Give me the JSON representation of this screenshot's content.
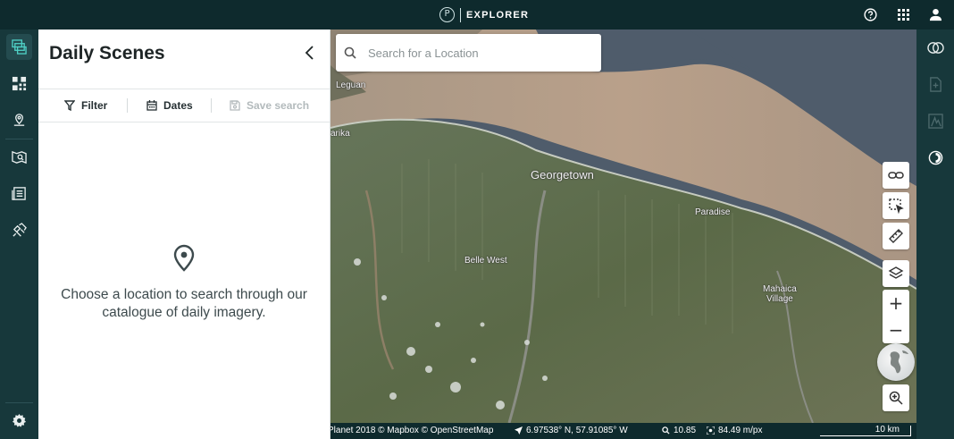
{
  "app": {
    "brand_letter": "P",
    "title": "EXPLORER"
  },
  "topbar_icons": [
    "help-icon",
    "apps-grid-icon",
    "user-account-icon"
  ],
  "left_nav": [
    "daily-scenes-icon",
    "basemaps-mosaic-icon",
    "places-pin-icon",
    "map-series-icon",
    "orders-list-icon",
    "tasking-satellite-icon",
    "settings-icon"
  ],
  "panel": {
    "title": "Daily Scenes",
    "filter_label": "Filter",
    "dates_label": "Dates",
    "save_search_label": "Save search",
    "empty_message": "Choose a location to search through our catalogue of daily imagery."
  },
  "search": {
    "placeholder": "Search for a Location"
  },
  "map": {
    "labels": {
      "leguan": "Leguan",
      "parika": "arika",
      "georgetown": "Georgetown",
      "paradise": "Paradise",
      "belle_west": "Belle West",
      "mahaica": "Mahaica",
      "village": "Village"
    },
    "controls": [
      "share-link-icon",
      "area-select-icon",
      "measure-ruler-icon",
      "layers-icon"
    ],
    "zoom_in": "+",
    "zoom_out": "−"
  },
  "status": {
    "attribution": "Planet 2018 © Mapbox © OpenStreetMap",
    "coordinates": "6.97538° N, 57.91085° W",
    "zoom_level": "10.85",
    "resolution": "84.49 m/px",
    "scale": "10 km"
  },
  "right_rail": [
    "compare-icon",
    "add-layer-icon",
    "elevation-profile-icon",
    "contrast-icon"
  ],
  "colors": {
    "header": "#0e2a2d",
    "rail": "#17383b",
    "water": "#4e5c6b",
    "sediment": "#b59d87",
    "land": "#5f6e4c"
  }
}
